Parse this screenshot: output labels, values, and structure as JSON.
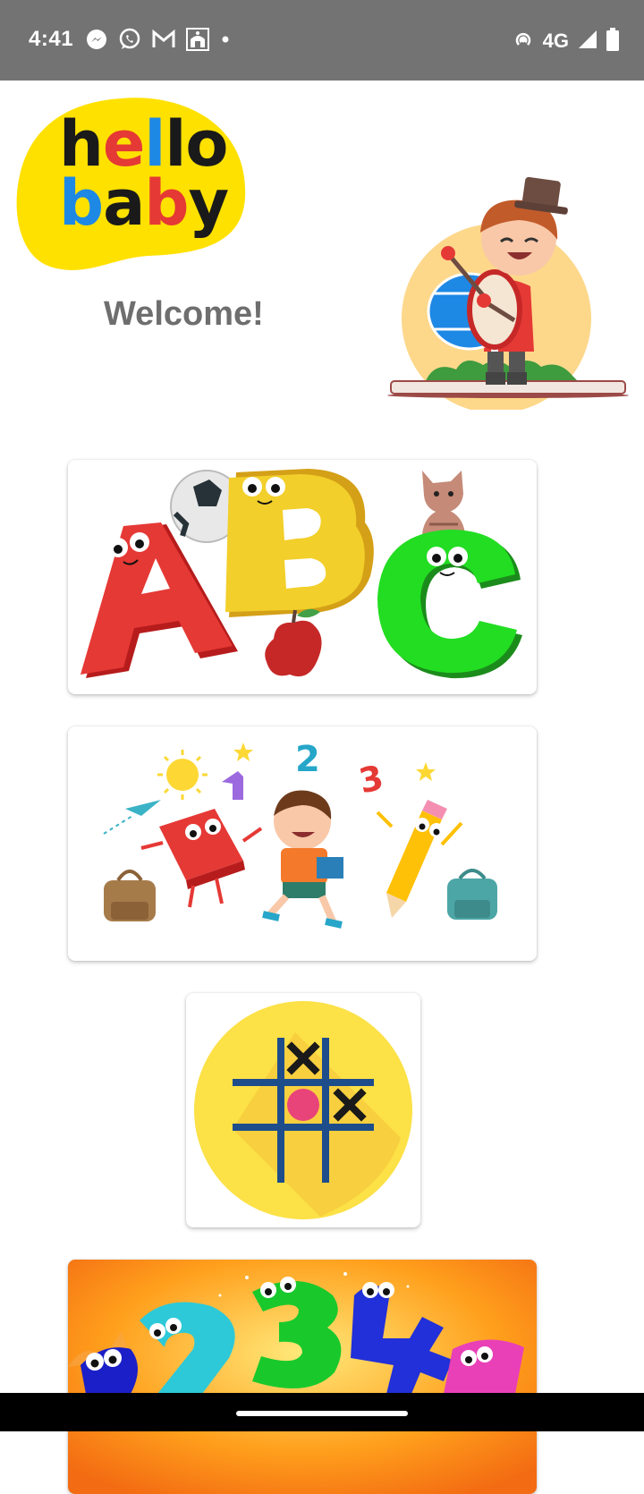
{
  "status_bar": {
    "time": "4:41",
    "network": "4G",
    "left_icons": [
      "messenger-icon",
      "whatsapp-icon",
      "gmail-icon",
      "mosque-app-icon",
      "dot-icon"
    ],
    "right_icons": [
      "hotspot-icon",
      "signal-icon",
      "battery-icon"
    ]
  },
  "header": {
    "logo_line1": [
      "h",
      "e",
      "l",
      "l",
      "o"
    ],
    "logo_line2": [
      "b",
      "a",
      "b",
      "y"
    ],
    "welcome": "Welcome!",
    "colors": {
      "logo_yellow": "#FFE100",
      "logo_red": "#E53935",
      "logo_blue": "#1E88E5",
      "logo_black": "#1A1A1A",
      "welcome_gray": "#6E6E6E"
    }
  },
  "cards": [
    {
      "name": "alphabet-card",
      "image": "abc-letters-illustration"
    },
    {
      "name": "school-card",
      "image": "school-kids-illustration"
    },
    {
      "name": "tictactoe-card",
      "image": "tic-tac-toe-icon"
    },
    {
      "name": "numbers-card",
      "image": "numbers-1234-illustration"
    }
  ]
}
